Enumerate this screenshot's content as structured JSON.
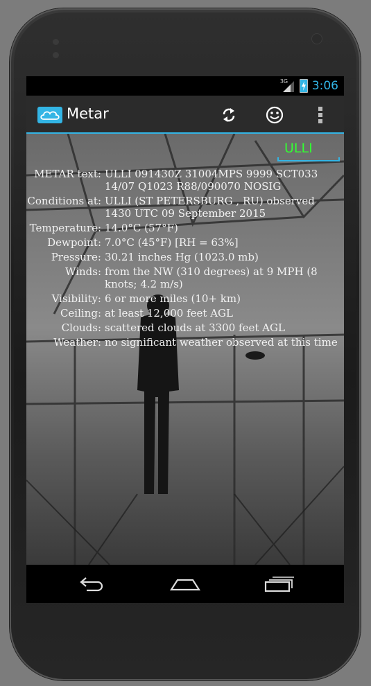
{
  "status_bar": {
    "network": "3G",
    "time": "3:06",
    "icons": [
      "signal-icon",
      "battery-charging-icon"
    ]
  },
  "action_bar": {
    "app_icon": "cloud-icon",
    "title": "Metar",
    "actions": [
      {
        "name": "refresh-icon"
      },
      {
        "name": "smiley-icon"
      },
      {
        "name": "overflow-menu-icon"
      }
    ]
  },
  "station_input": {
    "value": "ULLI"
  },
  "report": [
    {
      "label": "METAR text:",
      "value": "ULLI 091430Z 31004MPS 9999 SCT033 14/07 Q1023 R88/090070 NOSIG"
    },
    {
      "label": "Conditions at:",
      "value": "ULLI (ST PETERSBURG , RU) observed 1430 UTC 09 September 2015"
    },
    {
      "label": "Temperature:",
      "value": "14.0°C (57°F)"
    },
    {
      "label": "Dewpoint:",
      "value": "7.0°C (45°F) [RH = 63%]"
    },
    {
      "label": "Pressure:",
      "value": "30.21 inches Hg (1023.0 mb)"
    },
    {
      "label": "Winds:",
      "value": "from the NW (310 degrees) at 9 MPH (8 knots; 4.2 m/s)"
    },
    {
      "label": "Visibility:",
      "value": "6 or more miles (10+ km)"
    },
    {
      "label": "Ceiling:",
      "value": "at least 12,000 feet AGL"
    },
    {
      "label": "Clouds:",
      "value": "scattered clouds at 3300 feet AGL"
    },
    {
      "label": "Weather:",
      "value": "no significant weather observed at this time"
    }
  ],
  "nav_bar": {
    "buttons": [
      "back-icon",
      "home-icon",
      "recent-apps-icon"
    ]
  },
  "colors": {
    "accent": "#33b5e5",
    "station_text": "#33ff33"
  }
}
